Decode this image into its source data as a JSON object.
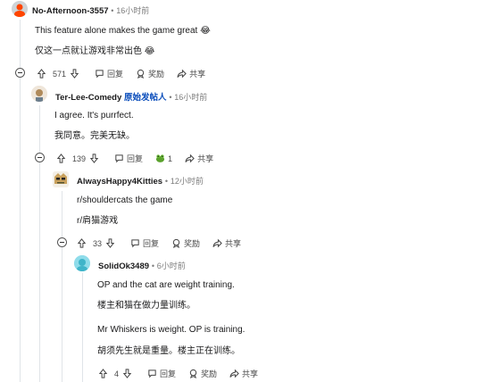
{
  "comments": [
    {
      "user": "No-Afternoon-3557",
      "time": "16小时前",
      "lines": [
        "This feature alone makes the game great 😂",
        "仅这一点就让游戏非常出色 😂"
      ],
      "votes": "571",
      "reply_label": "回复",
      "award_label": "奖励",
      "share_label": "共享"
    },
    {
      "user": "Ter-Lee-Comedy",
      "op_badge": "原始发帖人",
      "time": "16小时前",
      "lines": [
        "I agree. It's purrfect.",
        "我同意。完美无缺。"
      ],
      "votes": "139",
      "reply_label": "回复",
      "award_count": "1",
      "share_label": "共享"
    },
    {
      "user": "AlwaysHappy4Kitties",
      "time": "12小时前",
      "lines": [
        "r/shouldercats the game",
        "r/肩猫游戏"
      ],
      "votes": "33",
      "reply_label": "回复",
      "award_label": "奖励",
      "share_label": "共享"
    },
    {
      "user": "SolidOk3489",
      "time": "6小时前",
      "lines": [
        "OP and the cat are weight training.",
        "楼主和猫在做力量训练。",
        "Mr Whiskers is weight. OP is training.",
        "胡须先生就是重量。楼主正在训练。"
      ],
      "votes": "4",
      "reply_label": "回复",
      "award_label": "奖励",
      "share_label": "共享"
    }
  ],
  "dot": "•",
  "colors": {
    "op_badge": "#0a4dbb",
    "thread": "#e0e4e8"
  }
}
